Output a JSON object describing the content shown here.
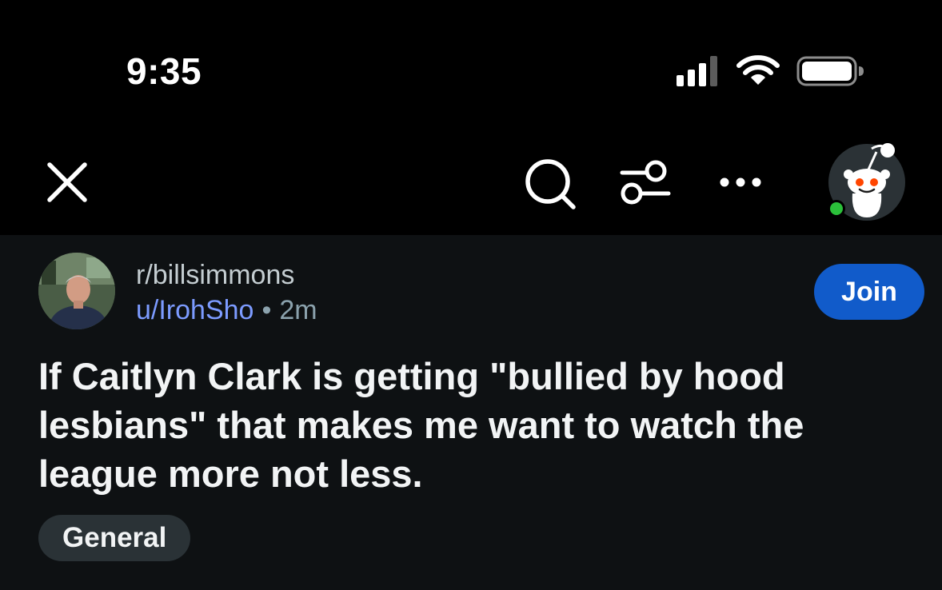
{
  "status_bar": {
    "time": "9:35",
    "signal_icon": "cellular-signal-icon",
    "wifi_icon": "wifi-icon",
    "battery_icon": "battery-icon"
  },
  "nav": {
    "close_icon": "close-icon",
    "search_icon": "search-icon",
    "filter_icon": "sort-filter-icon",
    "more_icon": "more-options-icon",
    "avatar_icon": "reddit-snoo-avatar",
    "online_color": "#2bc03a"
  },
  "post": {
    "community": "r/billsimmons",
    "author": "u/IrohSho",
    "separator": "•",
    "age": "2m",
    "join_label": "Join",
    "title": "If Caitlyn Clark is getting \"bullied by hood lesbians\" that makes me want to watch the league more not less.",
    "flair": "General"
  },
  "colors": {
    "background": "#0e1113",
    "header": "#000000",
    "accent": "#115bca",
    "author_link": "#7c9bff",
    "flair_bg": "#2a3236"
  }
}
